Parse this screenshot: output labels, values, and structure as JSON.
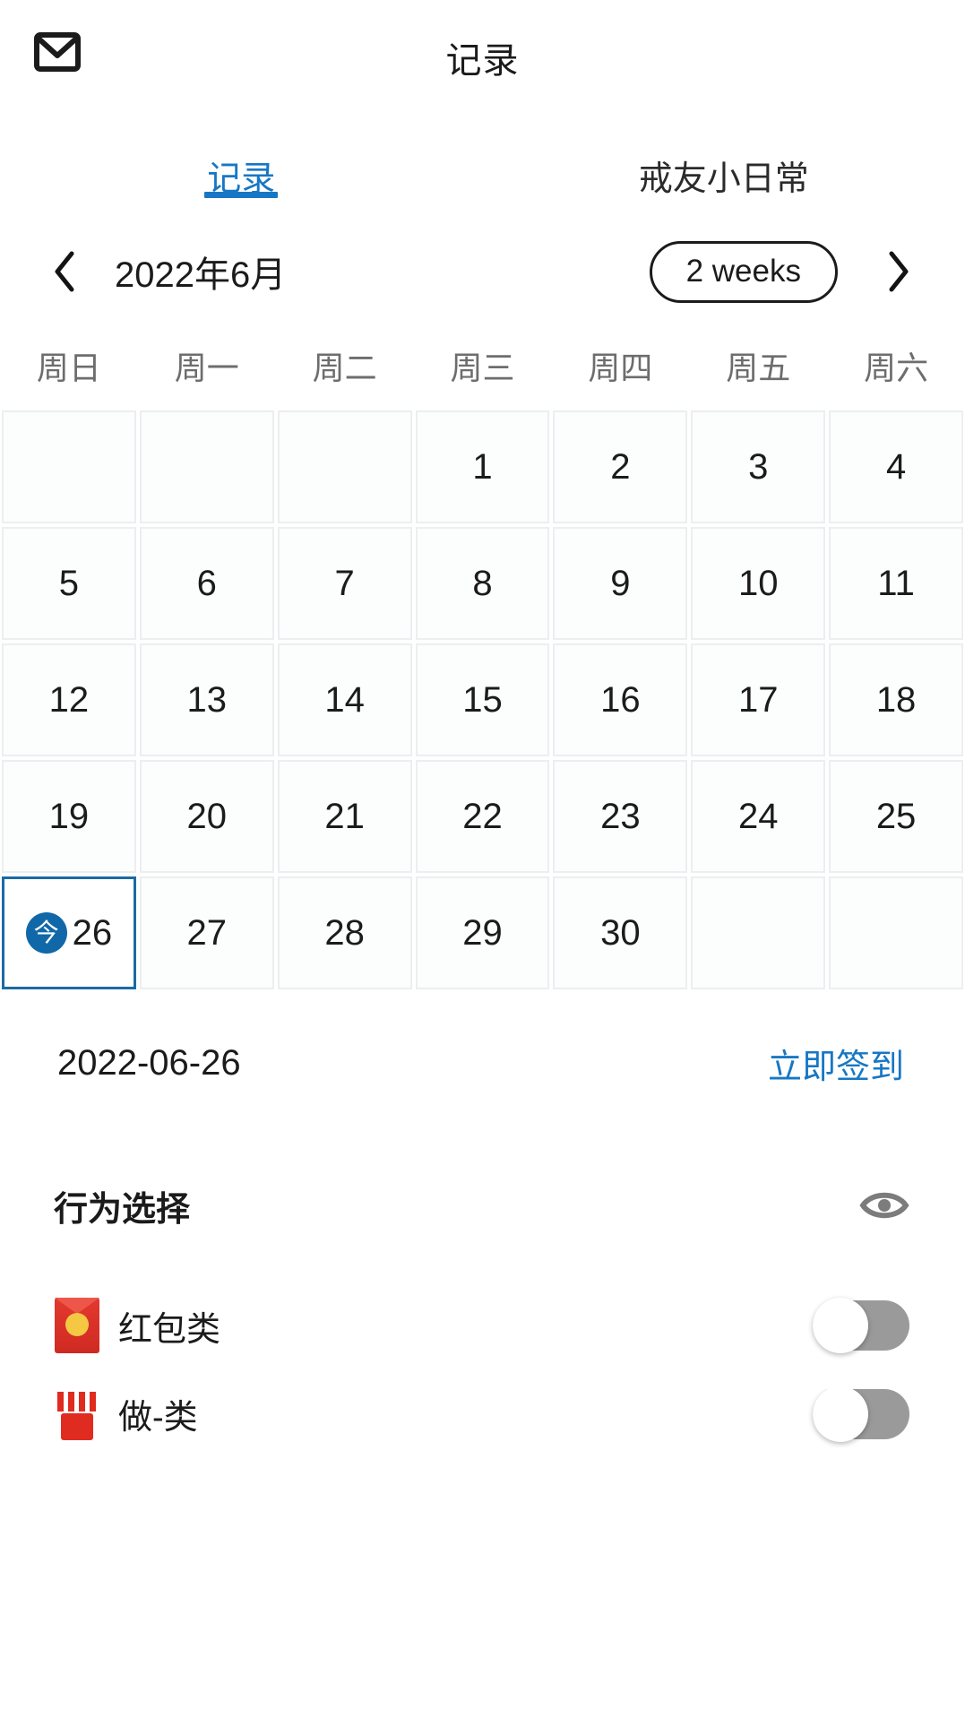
{
  "header": {
    "title": "记录",
    "mail_icon": "mail-icon"
  },
  "tabs": [
    {
      "label": "记录",
      "active": true
    },
    {
      "label": "戒友小日常",
      "active": false
    }
  ],
  "month_nav": {
    "prev_icon": "chevron-left-icon",
    "next_icon": "chevron-right-icon",
    "month_label": "2022年6月",
    "range_label": "2 weeks"
  },
  "weekdays": [
    "周日",
    "周一",
    "周二",
    "周三",
    "周四",
    "周五",
    "周六"
  ],
  "calendar": {
    "leading_blanks": 3,
    "days": [
      1,
      2,
      3,
      4,
      5,
      6,
      7,
      8,
      9,
      10,
      11,
      12,
      13,
      14,
      15,
      16,
      17,
      18,
      19,
      20,
      21,
      22,
      23,
      24,
      25,
      26,
      27,
      28,
      29,
      30
    ],
    "trailing_blanks": 2,
    "today": 26,
    "today_badge": "今"
  },
  "selected_date": {
    "date_text": "2022-06-26",
    "checkin_label": "立即签到"
  },
  "behaviour_section": {
    "title": "行为选择",
    "eye_icon": "eye-icon",
    "items": [
      {
        "label": "红包类",
        "icon": "red-envelope-icon",
        "enabled": false
      },
      {
        "label": "做-类",
        "icon": "firecracker-icon",
        "enabled": false
      }
    ]
  },
  "colors": {
    "accent": "#1777c4",
    "today_border": "#1b6aa5",
    "today_badge_bg": "#1068a8",
    "cell_border": "#eceef0",
    "toggle_off": "#9a9a9a",
    "text": "#1b1b1b",
    "muted": "#6d6d6d"
  }
}
